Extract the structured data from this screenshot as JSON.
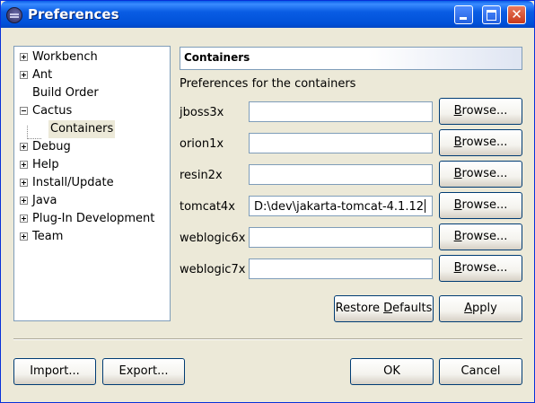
{
  "window": {
    "title": "Preferences",
    "controls": {
      "minimize": "",
      "maximize": "",
      "close": "✕"
    }
  },
  "tree": {
    "items": [
      {
        "label": "Workbench",
        "expander": "plus"
      },
      {
        "label": "Ant",
        "expander": "plus"
      },
      {
        "label": "Build Order",
        "expander": "none"
      },
      {
        "label": "Cactus",
        "expander": "minus"
      },
      {
        "label": "Containers",
        "expander": "none",
        "child": true,
        "selected": true
      },
      {
        "label": "Debug",
        "expander": "plus"
      },
      {
        "label": "Help",
        "expander": "plus"
      },
      {
        "label": "Install/Update",
        "expander": "plus"
      },
      {
        "label": "Java",
        "expander": "plus"
      },
      {
        "label": "Plug-In Development",
        "expander": "plus"
      },
      {
        "label": "Team",
        "expander": "plus"
      }
    ]
  },
  "panel": {
    "title": "Containers",
    "description": "Preferences for the containers",
    "containers": [
      {
        "label": "jboss3x",
        "value": ""
      },
      {
        "label": "orion1x",
        "value": ""
      },
      {
        "label": "resin2x",
        "value": ""
      },
      {
        "label": "tomcat4x",
        "value": "D:\\dev\\jakarta-tomcat-4.1.12"
      },
      {
        "label": "weblogic6x",
        "value": ""
      },
      {
        "label": "weblogic7x",
        "value": ""
      }
    ],
    "browse_label": "Browse...",
    "browse_mnemonic": "B",
    "browse_rest": "rowse...",
    "restore_defaults": {
      "pre": "Restore ",
      "mnemonic": "D",
      "post": "efaults"
    },
    "apply": {
      "mnemonic": "A",
      "post": "pply"
    }
  },
  "footer": {
    "import": "Import...",
    "export": "Export...",
    "ok": "OK",
    "cancel": "Cancel"
  },
  "colors": {
    "titlebar": "#0054E3",
    "dialog_bg": "#ECE9D8",
    "field_border": "#7F9DB9",
    "button_border": "#003C74"
  }
}
